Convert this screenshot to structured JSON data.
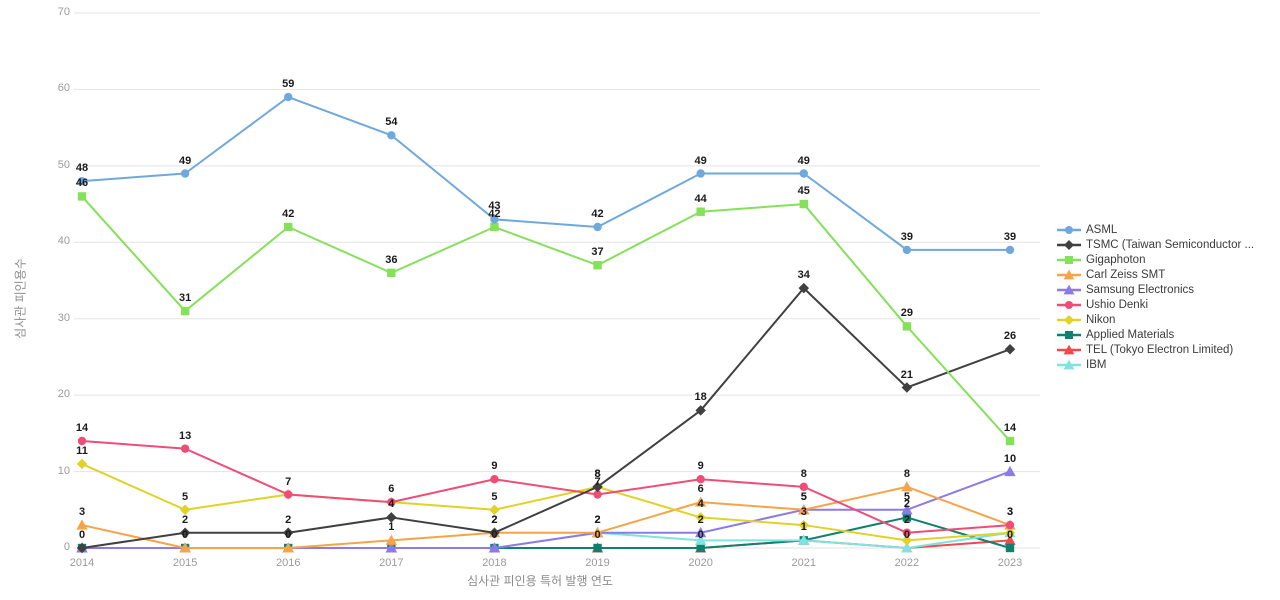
{
  "chart_data": {
    "type": "line",
    "title": "",
    "xlabel": "심사관 피인용 특허 발행 연도",
    "ylabel": "심사관 피인용수",
    "categories": [
      "2014",
      "2015",
      "2016",
      "2017",
      "2018",
      "2019",
      "2020",
      "2021",
      "2022",
      "2023"
    ],
    "ylim": [
      0,
      70
    ],
    "yticks": [
      0,
      10,
      20,
      30,
      40,
      50,
      60,
      70
    ],
    "grid": true,
    "legend_position": "right",
    "series": [
      {
        "name": "ASML",
        "color": "#6fa8dc",
        "marker": "circle",
        "values": [
          48,
          49,
          59,
          54,
          43,
          42,
          49,
          49,
          39,
          39
        ]
      },
      {
        "name": "TSMC (Taiwan Semiconductor ...",
        "color": "#404040",
        "marker": "diamond",
        "values": [
          0,
          2,
          2,
          4,
          2,
          8,
          18,
          34,
          21,
          26
        ]
      },
      {
        "name": "Gigaphoton",
        "color": "#85e05a",
        "marker": "square",
        "values": [
          46,
          31,
          42,
          36,
          42,
          37,
          44,
          45,
          29,
          14
        ]
      },
      {
        "name": "Carl Zeiss SMT",
        "color": "#f5a44a",
        "marker": "triangle",
        "values": [
          3,
          0,
          0,
          1,
          2,
          2,
          6,
          5,
          8,
          3
        ]
      },
      {
        "name": "Samsung Electronics",
        "color": "#8c7ae6",
        "marker": "triangle",
        "values": [
          0,
          0,
          0,
          0,
          0,
          2,
          2,
          5,
          5,
          10
        ]
      },
      {
        "name": "Ushio Denki",
        "color": "#ee4d78",
        "marker": "circle",
        "values": [
          14,
          13,
          7,
          6,
          9,
          7,
          9,
          8,
          2,
          3
        ]
      },
      {
        "name": "Nikon",
        "color": "#e0d228",
        "marker": "diamond",
        "values": [
          11,
          5,
          7,
          6,
          5,
          8,
          4,
          3,
          1,
          2
        ]
      },
      {
        "name": "Applied Materials",
        "color": "#11806f",
        "marker": "square",
        "values": [
          0,
          0,
          0,
          0,
          0,
          0,
          0,
          1,
          4,
          0
        ]
      },
      {
        "name": "TEL (Tokyo Electron Limited)",
        "color": "#ef4a4a",
        "marker": "triangle",
        "values": [
          0,
          0,
          0,
          0,
          0,
          0,
          0,
          1,
          0,
          1
        ]
      },
      {
        "name": "IBM",
        "color": "#7fe3e0",
        "marker": "triangle",
        "values": [
          0,
          0,
          0,
          0,
          0,
          2,
          1,
          1,
          0,
          2
        ]
      }
    ],
    "point_labels": [
      {
        "series": "ASML",
        "x": "2014",
        "y": 48,
        "text": "48"
      },
      {
        "series": "ASML",
        "x": "2015",
        "y": 49,
        "text": "49"
      },
      {
        "series": "ASML",
        "x": "2016",
        "y": 59,
        "text": "59"
      },
      {
        "series": "ASML",
        "x": "2017",
        "y": 54,
        "text": "54"
      },
      {
        "series": "ASML",
        "x": "2018",
        "y": 43,
        "text": "43"
      },
      {
        "series": "ASML",
        "x": "2019",
        "y": 42,
        "text": "42"
      },
      {
        "series": "ASML",
        "x": "2020",
        "y": 49,
        "text": "49"
      },
      {
        "series": "ASML",
        "x": "2021",
        "y": 49,
        "text": "49"
      },
      {
        "series": "ASML",
        "x": "2022",
        "y": 39,
        "text": "39"
      },
      {
        "series": "ASML",
        "x": "2023",
        "y": 39,
        "text": "39"
      },
      {
        "series": "Gigaphoton",
        "x": "2014",
        "y": 46,
        "text": "46"
      },
      {
        "series": "Gigaphoton",
        "x": "2015",
        "y": 31,
        "text": "31"
      },
      {
        "series": "Gigaphoton",
        "x": "2016",
        "y": 42,
        "text": "42"
      },
      {
        "series": "Gigaphoton",
        "x": "2017",
        "y": 36,
        "text": "36"
      },
      {
        "series": "Gigaphoton",
        "x": "2018",
        "y": 42,
        "text": "42"
      },
      {
        "series": "Gigaphoton",
        "x": "2019",
        "y": 37,
        "text": "37"
      },
      {
        "series": "Gigaphoton",
        "x": "2020",
        "y": 44,
        "text": "44"
      },
      {
        "series": "Gigaphoton",
        "x": "2021",
        "y": 45,
        "text": "45"
      },
      {
        "series": "Gigaphoton",
        "x": "2022",
        "y": 29,
        "text": "29"
      },
      {
        "series": "Gigaphoton",
        "x": "2023",
        "y": 14,
        "text": "14"
      },
      {
        "series": "TSMC",
        "x": "2015",
        "y": 2,
        "text": "2"
      },
      {
        "series": "TSMC",
        "x": "2016",
        "y": 2,
        "text": "2"
      },
      {
        "series": "TSMC",
        "x": "2017",
        "y": 4,
        "text": "4"
      },
      {
        "series": "TSMC",
        "x": "2018",
        "y": 2,
        "text": "2"
      },
      {
        "series": "TSMC",
        "x": "2019",
        "y": 8,
        "text": "8"
      },
      {
        "series": "TSMC",
        "x": "2020",
        "y": 18,
        "text": "18"
      },
      {
        "series": "TSMC",
        "x": "2021",
        "y": 34,
        "text": "34"
      },
      {
        "series": "TSMC",
        "x": "2022",
        "y": 21,
        "text": "21"
      },
      {
        "series": "TSMC",
        "x": "2023",
        "y": 26,
        "text": "26"
      },
      {
        "series": "Ushio Denki",
        "x": "2014",
        "y": 14,
        "text": "14"
      },
      {
        "series": "Ushio Denki",
        "x": "2015",
        "y": 13,
        "text": "13"
      },
      {
        "series": "Ushio Denki",
        "x": "2016",
        "y": 7,
        "text": "7"
      },
      {
        "series": "Ushio Denki",
        "x": "2018",
        "y": 9,
        "text": "9"
      },
      {
        "series": "Ushio Denki",
        "x": "2019",
        "y": 7,
        "text": "7"
      },
      {
        "series": "Ushio Denki",
        "x": "2020",
        "y": 9,
        "text": "9"
      },
      {
        "series": "Ushio Denki",
        "x": "2021",
        "y": 8,
        "text": "8"
      },
      {
        "series": "Ushio Denki",
        "x": "2022",
        "y": 2,
        "text": "2"
      },
      {
        "series": "Ushio Denki",
        "x": "2023",
        "y": 3,
        "text": "3"
      },
      {
        "series": "Nikon",
        "x": "2014",
        "y": 11,
        "text": "11"
      },
      {
        "series": "Nikon",
        "x": "2015",
        "y": 5,
        "text": "5"
      },
      {
        "series": "Nikon",
        "x": "2017",
        "y": 6,
        "text": "6"
      },
      {
        "series": "Nikon",
        "x": "2018",
        "y": 5,
        "text": "5"
      },
      {
        "series": "Nikon",
        "x": "2019",
        "y": 8,
        "text": "8"
      },
      {
        "series": "Nikon",
        "x": "2020",
        "y": 4,
        "text": "4"
      },
      {
        "series": "Nikon",
        "x": "2021",
        "y": 3,
        "text": "3"
      },
      {
        "series": "Carl Zeiss SMT",
        "x": "2014",
        "y": 3,
        "text": "3"
      },
      {
        "series": "Carl Zeiss SMT",
        "x": "2017",
        "y": 1,
        "text": "1"
      },
      {
        "series": "Carl Zeiss SMT",
        "x": "2018",
        "y": 2,
        "text": "2"
      },
      {
        "series": "Carl Zeiss SMT",
        "x": "2020",
        "y": 6,
        "text": "6"
      },
      {
        "series": "Carl Zeiss SMT",
        "x": "2021",
        "y": 5,
        "text": "5"
      },
      {
        "series": "Carl Zeiss SMT",
        "x": "2022",
        "y": 8,
        "text": "8"
      },
      {
        "series": "Carl Zeiss SMT",
        "x": "2023",
        "y": 3,
        "text": "3"
      },
      {
        "series": "Samsung Electronics",
        "x": "2019",
        "y": 2,
        "text": "2"
      },
      {
        "series": "Samsung Electronics",
        "x": "2020",
        "y": 2,
        "text": "2"
      },
      {
        "series": "Samsung Electronics",
        "x": "2021",
        "y": 5,
        "text": "5"
      },
      {
        "series": "Samsung Electronics",
        "x": "2022",
        "y": 5,
        "text": "5"
      },
      {
        "series": "Samsung Electronics",
        "x": "2023",
        "y": 10,
        "text": "10"
      },
      {
        "series": "IBM",
        "x": "2019",
        "y": 2,
        "text": "2"
      },
      {
        "series": "Applied Materials",
        "x": "2021",
        "y": 1,
        "text": "1"
      },
      {
        "series": "Applied Materials",
        "x": "2022",
        "y": 4,
        "text": "2"
      },
      {
        "series": "TEL",
        "x": "2014",
        "y": 0,
        "text": "0"
      },
      {
        "series": "TEL",
        "x": "2015",
        "y": 0,
        "text": "0"
      },
      {
        "series": "TEL",
        "x": "2016",
        "y": 0,
        "text": "0"
      },
      {
        "series": "TEL",
        "x": "2018",
        "y": 0,
        "text": "0"
      },
      {
        "series": "TEL",
        "x": "2019",
        "y": 0,
        "text": "0"
      },
      {
        "series": "TEL",
        "x": "2020",
        "y": 0,
        "text": "0"
      },
      {
        "series": "TEL",
        "x": "2022",
        "y": 0,
        "text": "0"
      },
      {
        "series": "TEL",
        "x": "2023",
        "y": 0,
        "text": "0"
      }
    ]
  }
}
